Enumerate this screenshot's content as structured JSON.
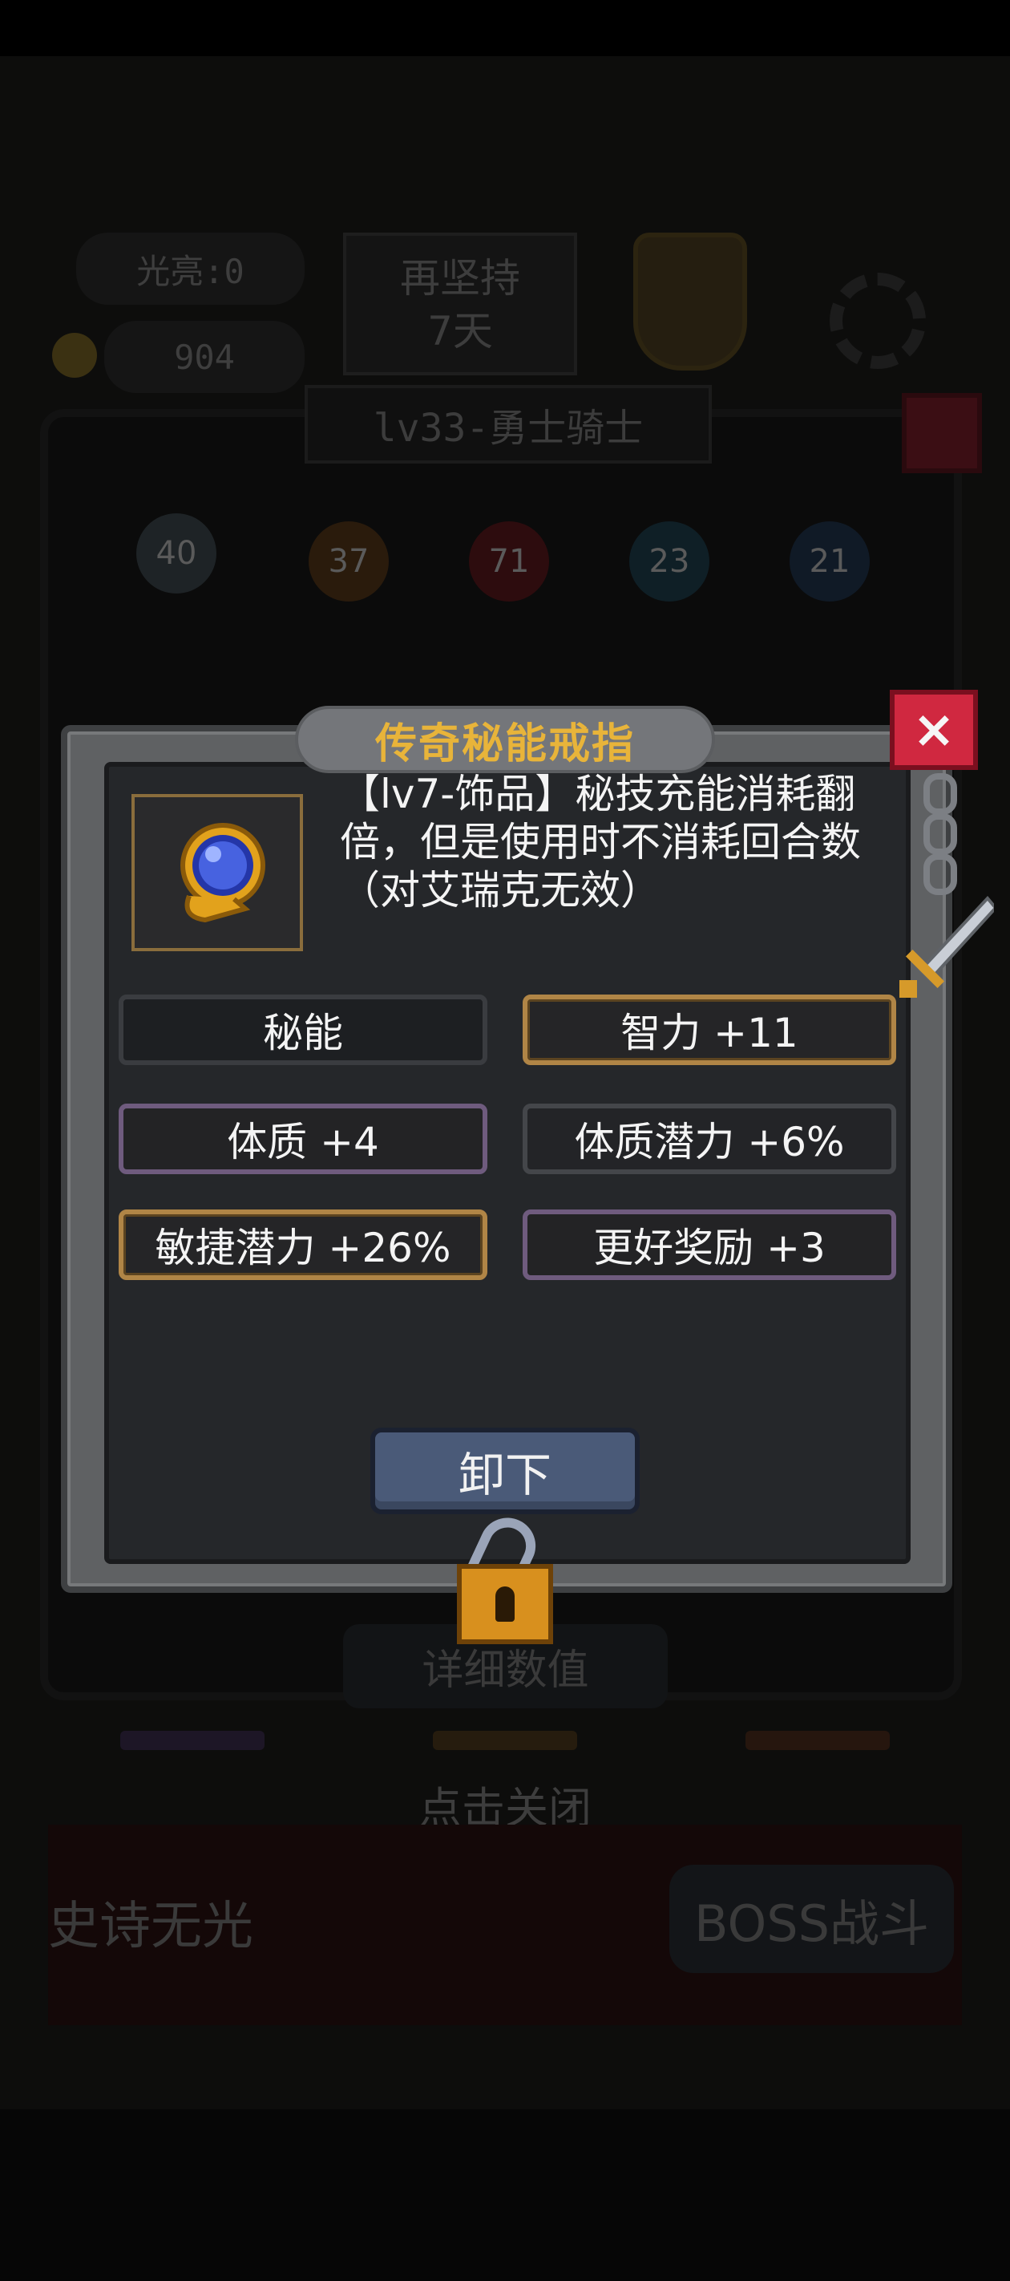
{
  "background": {
    "brightness_label": "光亮:0",
    "coins": "904",
    "persist_line1": "再坚持",
    "persist_line2": "7天",
    "class_title": "lv33-勇士骑士",
    "stat_icons": [
      "40",
      "37",
      "71",
      "23",
      "21"
    ],
    "details_button": "详细数值",
    "click_to_close": "点击关闭",
    "epic_label": "史诗无光",
    "boss_button": "BOSS战斗"
  },
  "modal": {
    "title": "传奇秘能戒指",
    "description": "【lv7-饰品】秘技充能消耗翻倍，但是使用时不消耗回合数（对艾瑞克无效）",
    "stats": [
      {
        "label": "秘能",
        "style": "plain"
      },
      {
        "label": "智力 +11",
        "style": "gold"
      },
      {
        "label": "体质  +4",
        "style": "purple"
      },
      {
        "label": "体质潜力 +6%",
        "style": "gray"
      },
      {
        "label": "敏捷潜力 +26%",
        "style": "gold"
      },
      {
        "label": "更好奖励  +3",
        "style": "purple"
      }
    ],
    "unequip_button": "卸下",
    "close_icon": "×"
  },
  "colors": {
    "title_gold": "#e8b43a",
    "close_red": "#d02840",
    "button_blue": "#4a5a78",
    "frame_gold": "#b08546",
    "frame_purple": "#6f5b7e"
  }
}
